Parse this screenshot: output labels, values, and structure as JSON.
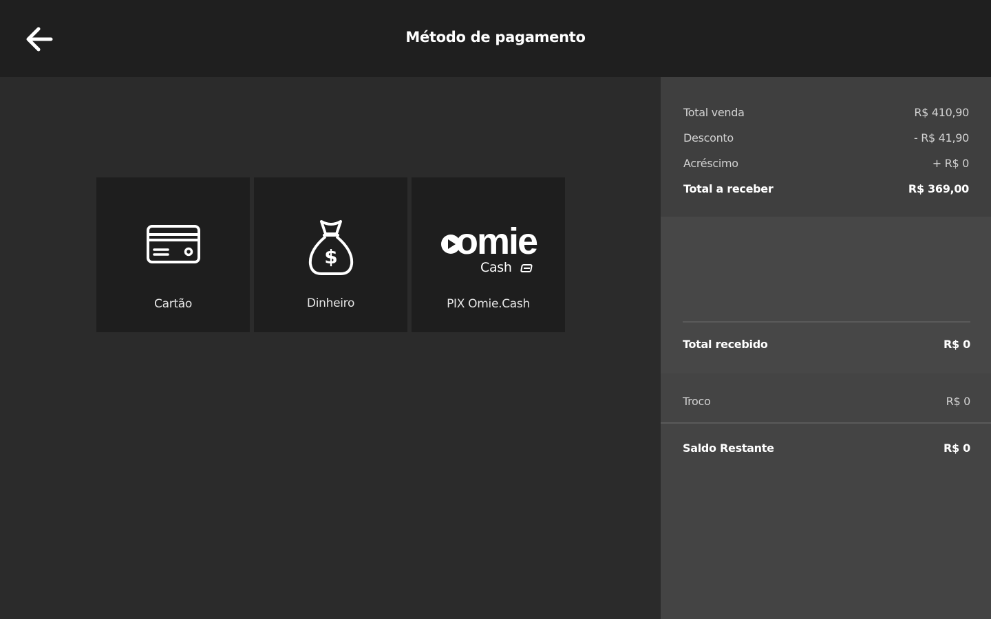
{
  "header": {
    "title": "Método de pagamento",
    "back_icon": "arrow-left-icon"
  },
  "methods": [
    {
      "label": "Cartão",
      "icon": "credit-card-icon"
    },
    {
      "label": "Dinheiro",
      "icon": "money-bag-icon"
    },
    {
      "label": "PIX Omie.Cash",
      "icon": "omie-cash-logo",
      "logo_text": "omie",
      "logo_sub": "Cash"
    }
  ],
  "summary": {
    "total_venda_label": "Total venda",
    "total_venda_value": "R$ 410,90",
    "desconto_label": "Desconto",
    "desconto_value": "- R$ 41,90",
    "acrescimo_label": "Acréscimo",
    "acrescimo_value": "+ R$ 0",
    "total_receber_label": "Total a receber",
    "total_receber_value": "R$ 369,00"
  },
  "received": {
    "label": "Total recebido",
    "value": "R$ 0"
  },
  "troco": {
    "label": "Troco",
    "value": "R$ 0"
  },
  "saldo": {
    "label": "Saldo Restante",
    "value": "R$ 0"
  },
  "colors": {
    "topbar": "#1f1f1f",
    "main_bg": "#2b2b2b",
    "card_bg": "#1e1e1e",
    "side_bg": "#444444"
  }
}
